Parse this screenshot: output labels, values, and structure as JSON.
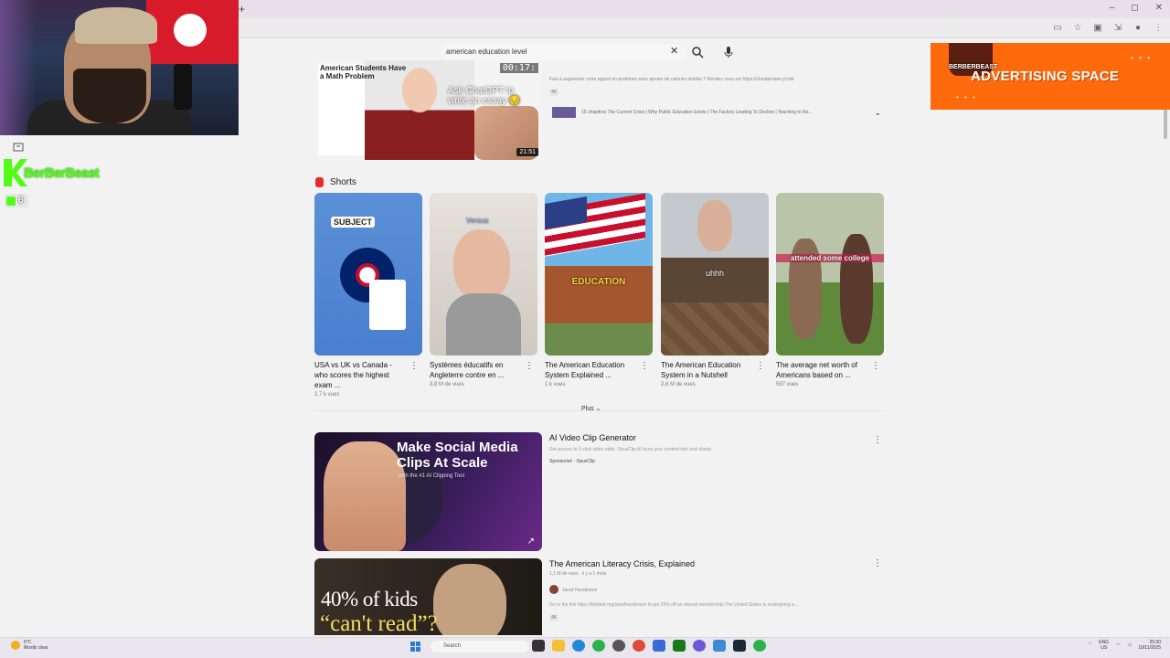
{
  "browser": {
    "new_tab": "+",
    "window_controls": [
      "–",
      "◻",
      "✕"
    ]
  },
  "search": {
    "query": "american education level",
    "clear_icon": "✕"
  },
  "top_video": {
    "thumb_title": "American Students Have a Math Problem",
    "thumb_caption": "Ask ChatGPT to write an essay 😔",
    "timer": "00:17:",
    "duration": "21:51",
    "description": "Fais à augmenter votre apport en protéines sans ajouter de calories inutiles ? Rendez vous sur https://cloudprotein.yt.link",
    "badge": "4K",
    "chapters": "15 chapitres The Current Crisis | Why Public Education Exists | The Factors Leading To Decline | Teaching to No..."
  },
  "shorts": {
    "title": "Shorts",
    "items": [
      {
        "title": "USA vs UK vs Canada - who scores the highest exam ...",
        "views": "2,7 k vues",
        "caption": "SUBJECT"
      },
      {
        "title": "Systèmes éducatifs en Angleterre contre en ...",
        "views": "3,8 M de vues",
        "caption": "Versus"
      },
      {
        "title": "The American Education System Explained ...",
        "views": "1 k vues",
        "caption": "EDUCATION"
      },
      {
        "title": "The American Education System in a Nutshell",
        "views": "2,6 M de vues",
        "caption": "uhhh"
      },
      {
        "title": "The average net worth of Americans based on ...",
        "views": "597 vues",
        "caption": "attended some college"
      }
    ],
    "more_label": "Plus"
  },
  "ad_video": {
    "thumb_headline": "Make Social Media Clips At Scale",
    "thumb_sub": "with the #1 AI Clipping Tool",
    "title": "AI Video Clip Generator",
    "description": "Get access to 1-click video edits. OpusClip AI turns your content into viral shorts.",
    "sponsor": "Sponsorisé · OpusClip"
  },
  "literacy_video": {
    "thumb_line1": "40% of kids",
    "thumb_line2": "“can't read”?",
    "title": "The American Literacy Crisis, Explained",
    "meta": "1,1 M de vues · il y a 1 mois",
    "channel": "Jared Henderson",
    "description": "Go to the link https://brilliant.org/jaredhenderson to get 20% off an annual membership The United States is undergoing a ...",
    "badge": "4K"
  },
  "overlay": {
    "streamer": "BerBerBeast",
    "viewers": "6",
    "ad_banner": "ADVERTISING SPACE",
    "ad_logo": "BERBERBEAST"
  },
  "taskbar": {
    "weather_temp": "5°C",
    "weather_desc": "Mostly clear",
    "search_label": "Search",
    "lang": "ENG",
    "region": "US",
    "time": "20:30",
    "date": "10/11/2025"
  },
  "colors": {
    "kick_green": "#53fc18",
    "ad_orange": "#ff6a0d",
    "youtube_red": "#e52d27"
  }
}
